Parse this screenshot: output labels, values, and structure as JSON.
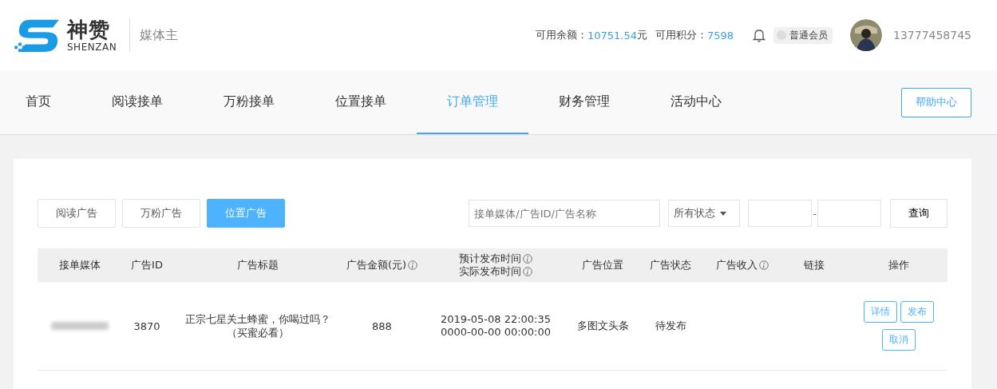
{
  "header": {
    "logo_cn": "神赞",
    "logo_en": "SHENZAN",
    "role": "媒体主",
    "balance_label": "可用余额：",
    "balance": "10751.54",
    "balance_unit": "元",
    "points_label": "可用积分：",
    "points": "7598",
    "membership": "普通会员",
    "phone": "13777458745"
  },
  "nav": {
    "items": [
      {
        "label": "首页",
        "selected": false
      },
      {
        "label": "阅读接单",
        "selected": false
      },
      {
        "label": "万粉接单",
        "selected": false
      },
      {
        "label": "位置接单",
        "selected": false
      },
      {
        "label": "订单管理",
        "selected": true
      },
      {
        "label": "财务管理",
        "selected": false
      },
      {
        "label": "活动中心",
        "selected": false
      }
    ],
    "help": "帮助中心"
  },
  "filters": {
    "tabs": [
      {
        "label": "阅读广告",
        "selected": false
      },
      {
        "label": "万粉广告",
        "selected": false
      },
      {
        "label": "位置广告",
        "selected": true
      }
    ],
    "search": {
      "placeholder": "接单媒体/广告ID/广告名称"
    },
    "status": "所有状态",
    "date_separator": "-",
    "query": "查询"
  },
  "table": {
    "columns": [
      {
        "lines": [
          "接单媒体"
        ],
        "info": false
      },
      {
        "lines": [
          "广告ID"
        ],
        "info": false
      },
      {
        "lines": [
          "广告标题"
        ],
        "info": false
      },
      {
        "lines": [
          "广告金额(元)"
        ],
        "info": true
      },
      {
        "lines": [
          "预计发布时间",
          "实际发布时间"
        ],
        "info": true
      },
      {
        "lines": [
          "广告位置"
        ],
        "info": false
      },
      {
        "lines": [
          "广告状态"
        ],
        "info": false
      },
      {
        "lines": [
          "广告收入"
        ],
        "info": true
      },
      {
        "lines": [
          "链接"
        ],
        "info": false
      },
      {
        "lines": [
          "操作"
        ],
        "info": false
      }
    ],
    "rows": [
      {
        "ad_id": "3870",
        "title": "正宗七星关土蜂蜜，你喝过吗？（买蜜必看）",
        "amount": "888",
        "times": [
          "2019-05-08 22:00:35",
          "0000-00-00 00:00:00"
        ],
        "position": "多图文头条",
        "status": "待发布",
        "actions": [
          "详情",
          "发布",
          "取消"
        ]
      }
    ]
  }
}
